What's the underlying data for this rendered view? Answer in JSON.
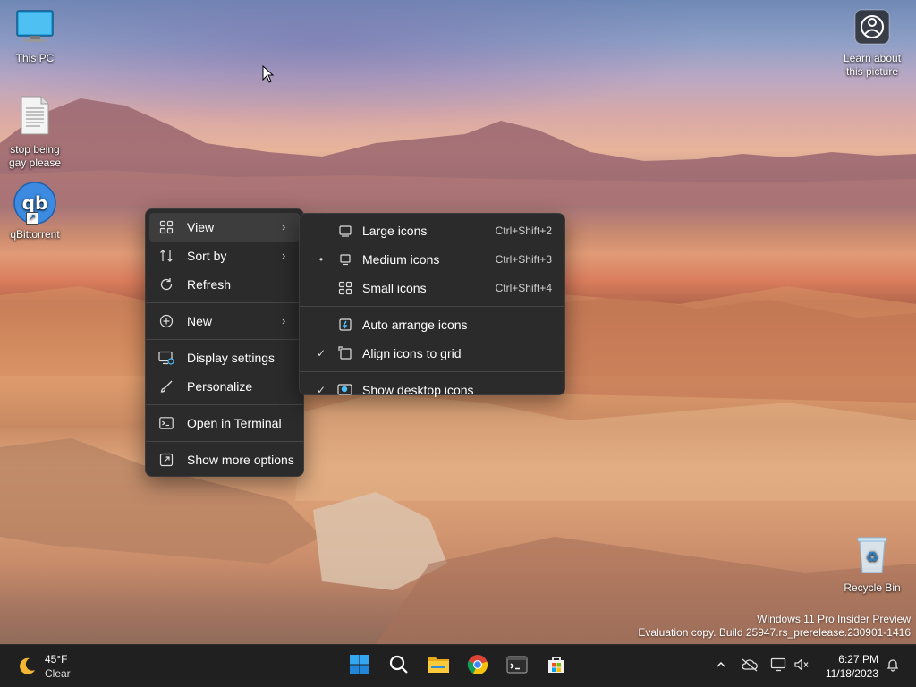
{
  "desktop": {
    "icons": [
      {
        "label": "This PC"
      },
      {
        "label": "stop being gay please"
      },
      {
        "label": "qBittorrent",
        "glyph": "qb"
      },
      {
        "label": "Recycle Bin"
      }
    ],
    "spotlight": {
      "label": "Learn about this picture"
    }
  },
  "context_menu": {
    "items": [
      {
        "label": "View",
        "icon": "grid-icon",
        "has_submenu": true
      },
      {
        "label": "Sort by",
        "icon": "sort-icon",
        "has_submenu": true
      },
      {
        "label": "Refresh",
        "icon": "refresh-icon"
      },
      {
        "label": "New",
        "icon": "plus-circle-icon",
        "has_submenu": true
      },
      {
        "label": "Display settings",
        "icon": "display-icon"
      },
      {
        "label": "Personalize",
        "icon": "brush-icon"
      },
      {
        "label": "Open in Terminal",
        "icon": "terminal-icon"
      },
      {
        "label": "Show more options",
        "icon": "open-external-icon"
      }
    ]
  },
  "view_submenu": {
    "items": [
      {
        "label": "Large icons",
        "shortcut": "Ctrl+Shift+2",
        "mark": ""
      },
      {
        "label": "Medium icons",
        "shortcut": "Ctrl+Shift+3",
        "mark": "•"
      },
      {
        "label": "Small icons",
        "shortcut": "Ctrl+Shift+4",
        "mark": ""
      },
      {
        "label": "Auto arrange icons",
        "mark": ""
      },
      {
        "label": "Align icons to grid",
        "mark": "✓"
      },
      {
        "label": "Show desktop icons",
        "mark": "✓"
      }
    ]
  },
  "watermark": {
    "line1": "Windows 11 Pro Insider Preview",
    "line2": "Evaluation copy. Build 25947.rs_prerelease.230901-1416"
  },
  "taskbar": {
    "weather": {
      "temp": "45°F",
      "condition": "Clear"
    },
    "apps": [
      "start-icon",
      "search-icon",
      "file-explorer-icon",
      "chrome-icon",
      "terminal-icon",
      "store-icon"
    ],
    "tray": {
      "chevron": "^"
    },
    "clock": {
      "time": "6:27 PM",
      "date": "11/18/2023"
    }
  },
  "colors": {
    "menu_bg": "#2b2b2b",
    "menu_hover": "#3d3d3d",
    "taskbar_bg": "#202020",
    "accent": "#4cc2ff"
  }
}
